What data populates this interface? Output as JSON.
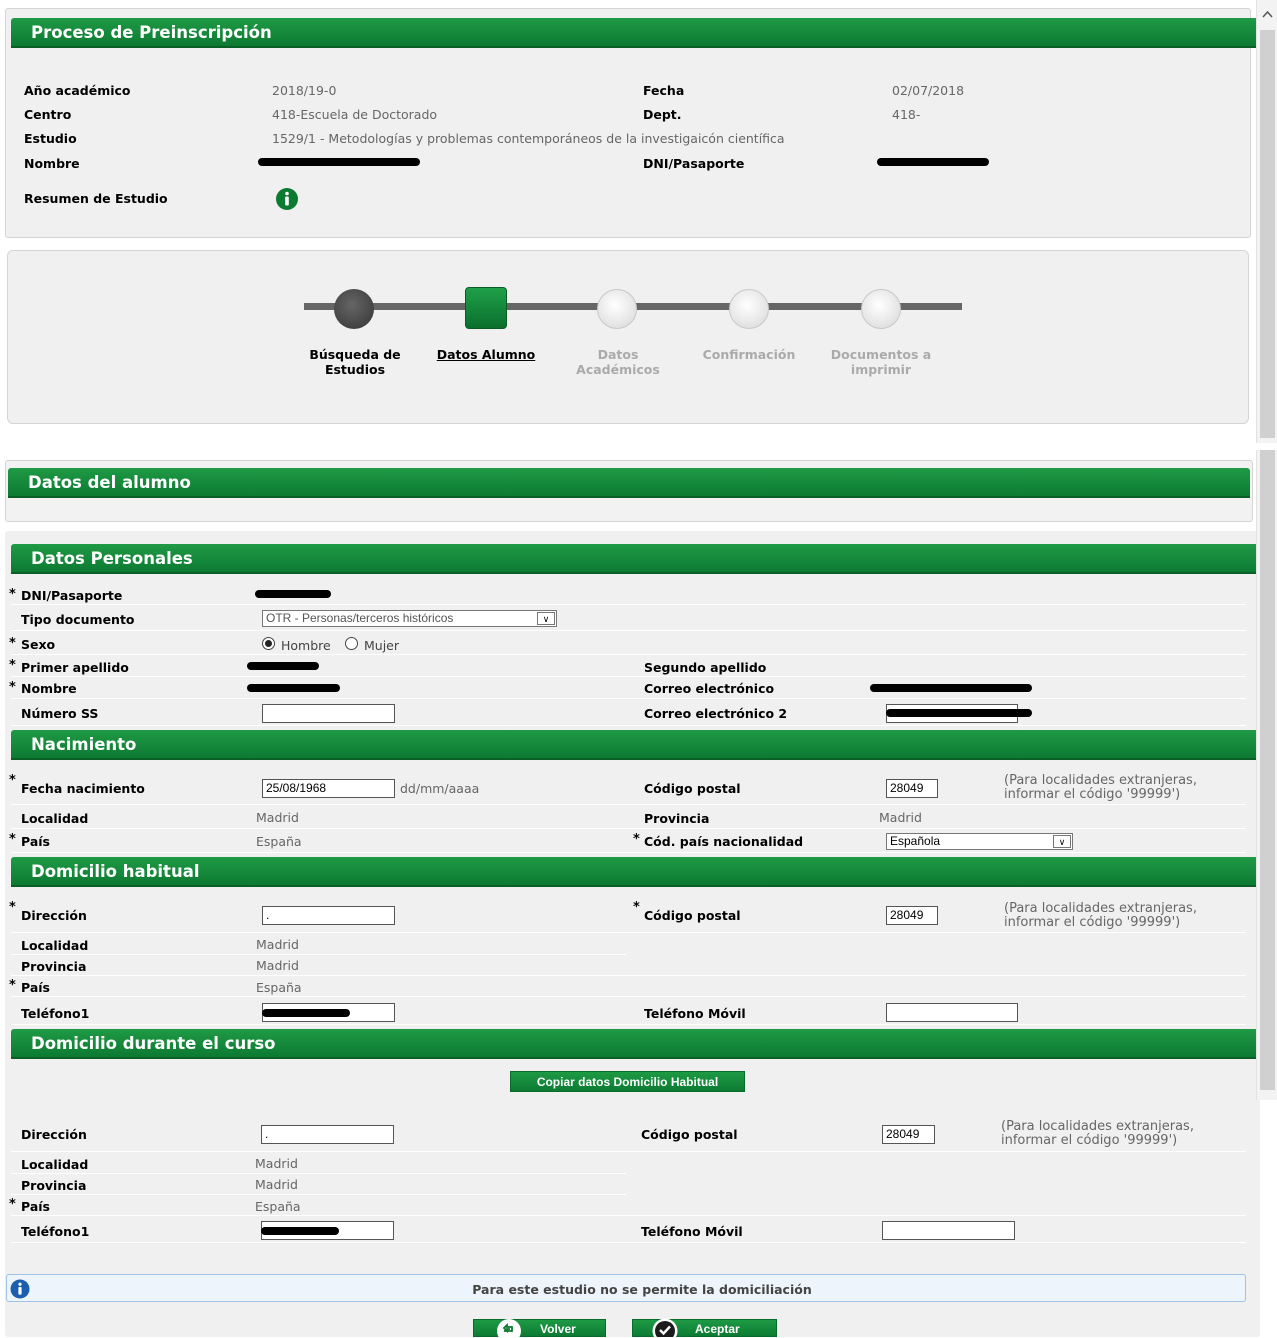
{
  "preinscripcion": {
    "title": "Proceso de Preinscripción",
    "anio_label": "Año académico",
    "anio_value": "2018/19-0",
    "fecha_label": "Fecha",
    "fecha_value": "02/07/2018",
    "centro_label": "Centro",
    "centro_value": "418-Escuela de Doctorado",
    "dept_label": "Dept.",
    "dept_value": "418-",
    "estudio_label": "Estudio",
    "estudio_value": "1529/1 - Metodologías y problemas contemporáneos de la investigaicón científica",
    "nombre_label": "Nombre",
    "dni_label": "DNI/Pasaporte",
    "resumen_label": "Resumen de Estudio"
  },
  "steps": [
    {
      "label": "Búsqueda de Estudios"
    },
    {
      "label": "Datos Alumno"
    },
    {
      "label": "Datos Académicos"
    },
    {
      "label": "Confirmación"
    },
    {
      "label": "Documentos a imprimir"
    }
  ],
  "alumno_title": "Datos del alumno",
  "personales": {
    "title": "Datos Personales",
    "dni_label": "DNI/Pasaporte",
    "tipo_label": "Tipo documento",
    "tipo_value": "OTR - Personas/terceros históricos",
    "sexo_label": "Sexo",
    "sexo_hombre": "Hombre",
    "sexo_mujer": "Mujer",
    "apellido1_label": "Primer apellido",
    "apellido2_label": "Segundo apellido",
    "nombre_label": "Nombre",
    "correo_label": "Correo electrónico",
    "numss_label": "Número SS",
    "correo2_label": "Correo electrónico 2"
  },
  "nacimiento": {
    "title": "Nacimiento",
    "fecha_label": "Fecha nacimiento",
    "fecha_value": "25/08/1968",
    "fecha_hint": "dd/mm/aaaa",
    "cp_label": "Código postal",
    "cp_value": "28049",
    "cp_note": "(Para localidades extranjeras, informar el código '99999')",
    "localidad_label": "Localidad",
    "localidad_value": "Madrid",
    "provincia_label": "Provincia",
    "provincia_value": "Madrid",
    "pais_label": "País",
    "pais_value": "España",
    "nacionalidad_label": "Cód. país nacionalidad",
    "nacionalidad_value": "Española"
  },
  "habitual": {
    "title": "Domicilio habitual",
    "direccion_label": "Dirección",
    "direccion_value": ".",
    "cp_label": "Código postal",
    "cp_value": "28049",
    "cp_note": "(Para localidades extranjeras, informar el código '99999')",
    "localidad_label": "Localidad",
    "localidad_value": "Madrid",
    "provincia_label": "Provincia",
    "provincia_value": "Madrid",
    "pais_label": "País",
    "pais_value": "España",
    "telefono_label": "Teléfono1",
    "movil_label": "Teléfono Móvil"
  },
  "curso": {
    "title": "Domicilio durante el curso",
    "copiar_label": "Copiar datos Domicilio Habitual",
    "direccion_label": "Dirección",
    "direccion_value": ".",
    "cp_label": "Código postal",
    "cp_value": "28049",
    "cp_note": "(Para localidades extranjeras, informar el código '99999')",
    "localidad_label": "Localidad",
    "localidad_value": "Madrid",
    "provincia_label": "Provincia",
    "provincia_value": "Madrid",
    "pais_label": "País",
    "pais_value": "España",
    "telefono_label": "Teléfono1",
    "movil_label": "Teléfono Móvil"
  },
  "info_message": "Para este estudio no se permite la domiciliación",
  "buttons": {
    "volver": "Volver",
    "aceptar": "Aceptar"
  },
  "colors": {
    "green": "#0d7a32",
    "panel": "#f0f0f0"
  }
}
